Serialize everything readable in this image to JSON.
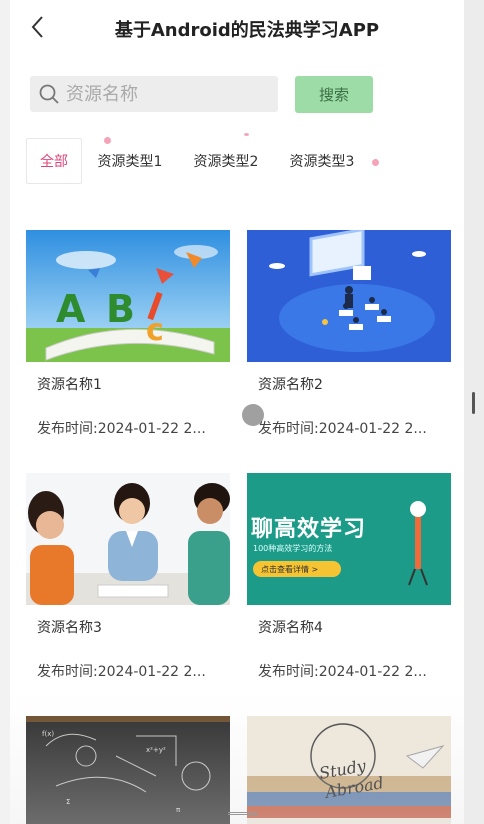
{
  "header": {
    "title": "基于Android的民法典学习APP",
    "back_icon": "chevron-left-icon"
  },
  "search": {
    "placeholder": "资源名称",
    "button_label": "搜索",
    "icon": "search-icon"
  },
  "tabs": [
    {
      "label": "全部",
      "active": true
    },
    {
      "label": "资源类型1",
      "active": false
    },
    {
      "label": "资源类型2",
      "active": false
    },
    {
      "label": "资源类型3",
      "active": false
    }
  ],
  "cards": [
    {
      "name": "资源名称1",
      "date": "发布时间:2024-01-22 2...",
      "image": "abc-book-illustration"
    },
    {
      "name": "资源名称2",
      "date": "发布时间:2024-01-22 2...",
      "image": "classroom-isometric-illustration"
    },
    {
      "name": "资源名称3",
      "date": "发布时间:2024-01-22 2...",
      "image": "teacher-with-children-photo"
    },
    {
      "name": "资源名称4",
      "date": "发布时间:2024-01-22 2...",
      "image": "efficient-study-banner"
    },
    {
      "name": "",
      "date": "",
      "image": "chalkboard-formulas-photo"
    },
    {
      "name": "",
      "date": "",
      "image": "study-abroad-books-photo"
    }
  ],
  "banner4": {
    "headline": "聊高效学习",
    "subline": "100种高效学习的方法",
    "cta": "点击查看详情 >"
  },
  "banner6": {
    "text_line1": "Study",
    "text_line2": "Abroad"
  },
  "colors": {
    "accent_pink": "#e0457b",
    "search_button": "#9ddba7"
  }
}
